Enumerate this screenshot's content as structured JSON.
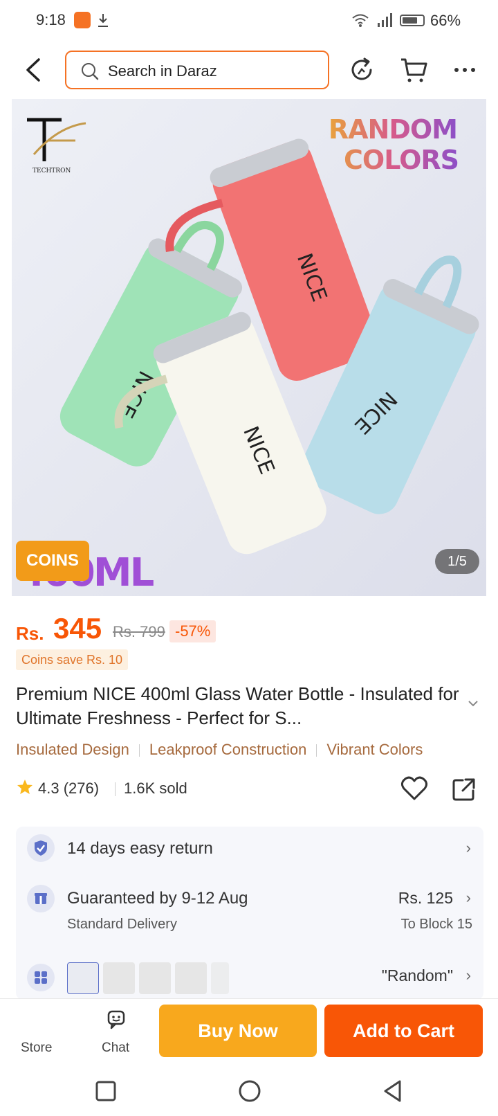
{
  "status_bar": {
    "time": "9:18",
    "battery": "66%",
    "battery_level": 0.66
  },
  "header": {
    "search_placeholder": "Search in Daraz"
  },
  "hero": {
    "brand": "TECHTRON",
    "overlay_line1": "RANDOM",
    "overlay_line2": "COLORS",
    "coins_badge": "COINS",
    "capacity_text": "400ML",
    "counter": "1/5",
    "bottle_label": "NICE"
  },
  "price": {
    "currency": "Rs.",
    "current": "345",
    "original": "Rs. 799",
    "discount": "-57%",
    "coins_save": "Coins save Rs. 10"
  },
  "product": {
    "title": "Premium NICE 400ml Glass Water Bottle - Insulated for Ultimate Freshness - Perfect for S...",
    "tags": [
      "Insulated Design",
      "Leakproof Construction",
      "Vibrant Colors"
    ],
    "rating": "4.3",
    "reviews": "(276)",
    "sold": "1.6K sold"
  },
  "info": {
    "return": "14 days easy return",
    "delivery_title": "Guaranteed by 9-12 Aug",
    "delivery_type": "Standard Delivery",
    "delivery_price": "Rs. 125",
    "delivery_to": "To Block 15",
    "variant_value": "\"Random\""
  },
  "bottom_bar": {
    "store": "Store",
    "chat": "Chat",
    "buy_now": "Buy Now",
    "add_to_cart": "Add to Cart"
  },
  "colors": {
    "accent": "#f85606",
    "buy_now": "#f8a81d",
    "search_border": "#f57224"
  }
}
